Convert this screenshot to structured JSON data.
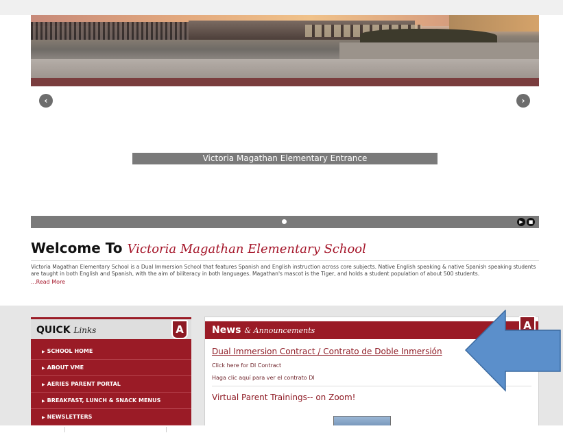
{
  "carousel": {
    "caption": "Victoria Magathan Elementary Entrance",
    "prev_icon": "chevron-left-icon",
    "next_icon": "chevron-right-icon",
    "prev_glyph": "‹",
    "next_glyph": "›",
    "play_glyph": "▶",
    "stop_glyph": "■"
  },
  "welcome": {
    "title_prefix": "Welcome To",
    "title_script": "Victoria Magathan Elementary School",
    "body": "Victoria Magathan Elementary School is a Dual Immersion School that features Spanish and English instruction across core subjects. Native English speaking & native Spanish speaking students are taught in both English and Spanish, with the aim of biliteracy in both languages. Magathan's mascot is the Tiger, and holds a student population of about 500 students.",
    "read_more": "...Read More"
  },
  "quick_links": {
    "title": "QUICK",
    "title_script": "Links",
    "badge": "A",
    "items": [
      {
        "label": "SCHOOL HOME"
      },
      {
        "label": "ABOUT VME"
      },
      {
        "label": "AERIES PARENT PORTAL"
      },
      {
        "label": "BREAKFAST, LUNCH & SNACK MENUS"
      },
      {
        "label": "NEWSLETTERS"
      }
    ]
  },
  "news": {
    "title": "News",
    "title_script": "& Announcements",
    "badge": "A",
    "items": [
      {
        "title": "Dual Immersion Contract / Contrato de Doble Inmersión",
        "line1": "Click here for DI Contract",
        "line2": "Haga clic aquí para ver el contrato DI"
      },
      {
        "title": "Virtual Parent Trainings-- on Zoom!"
      }
    ]
  },
  "colors": {
    "brand": "#9a1b26",
    "arrow": "#5b8fcb"
  }
}
